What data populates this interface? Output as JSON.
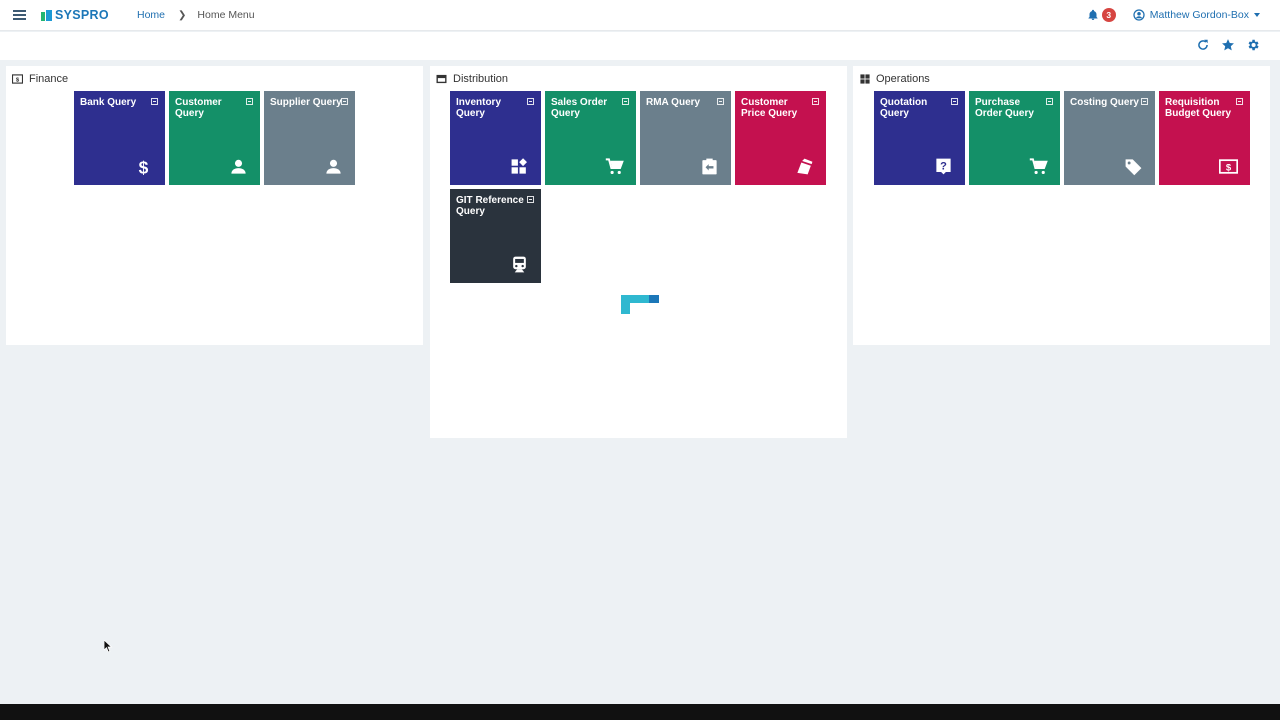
{
  "app": {
    "logo_text": "SYSPRO"
  },
  "header": {
    "menu_icon": "hamburger-icon",
    "breadcrumb": {
      "home": "Home",
      "current": "Home Menu"
    },
    "notifications_count": "3",
    "user_name": "Matthew Gordon-Box"
  },
  "toolbar": {
    "icons": [
      "refresh-icon",
      "favorite-star-icon",
      "settings-gear-icon"
    ]
  },
  "panels": {
    "finance": {
      "title": "Finance",
      "tiles": [
        {
          "label": "Bank Query",
          "color": "#2e2f8f",
          "icon": "dollar-icon"
        },
        {
          "label": "Customer Query",
          "color": "#149068",
          "icon": "person-icon"
        },
        {
          "label": "Supplier Query",
          "color": "#6b7f8c",
          "icon": "person-icon"
        }
      ]
    },
    "distribution": {
      "title": "Distribution",
      "tiles": [
        {
          "label": "Inventory Query",
          "color": "#2e2f8f",
          "icon": "widgets-icon"
        },
        {
          "label": "Sales Order Query",
          "color": "#149068",
          "icon": "cart-icon"
        },
        {
          "label": "RMA Query",
          "color": "#6b7f8c",
          "icon": "return-clipboard-icon"
        },
        {
          "label": "Customer Price Query",
          "color": "#c4114f",
          "icon": "price-cards-icon"
        },
        {
          "label": "GIT Reference Query",
          "color": "#2a333d",
          "icon": "train-icon"
        }
      ]
    },
    "operations": {
      "title": "Operations",
      "tiles": [
        {
          "label": "Quotation Query",
          "color": "#2e2f8f",
          "icon": "question-icon"
        },
        {
          "label": "Purchase Order Query",
          "color": "#149068",
          "icon": "cart-icon"
        },
        {
          "label": "Costing Query",
          "color": "#6b7f8c",
          "icon": "tag-icon"
        },
        {
          "label": "Requisition Budget Query",
          "color": "#c4114f",
          "icon": "money-icon"
        }
      ]
    }
  }
}
